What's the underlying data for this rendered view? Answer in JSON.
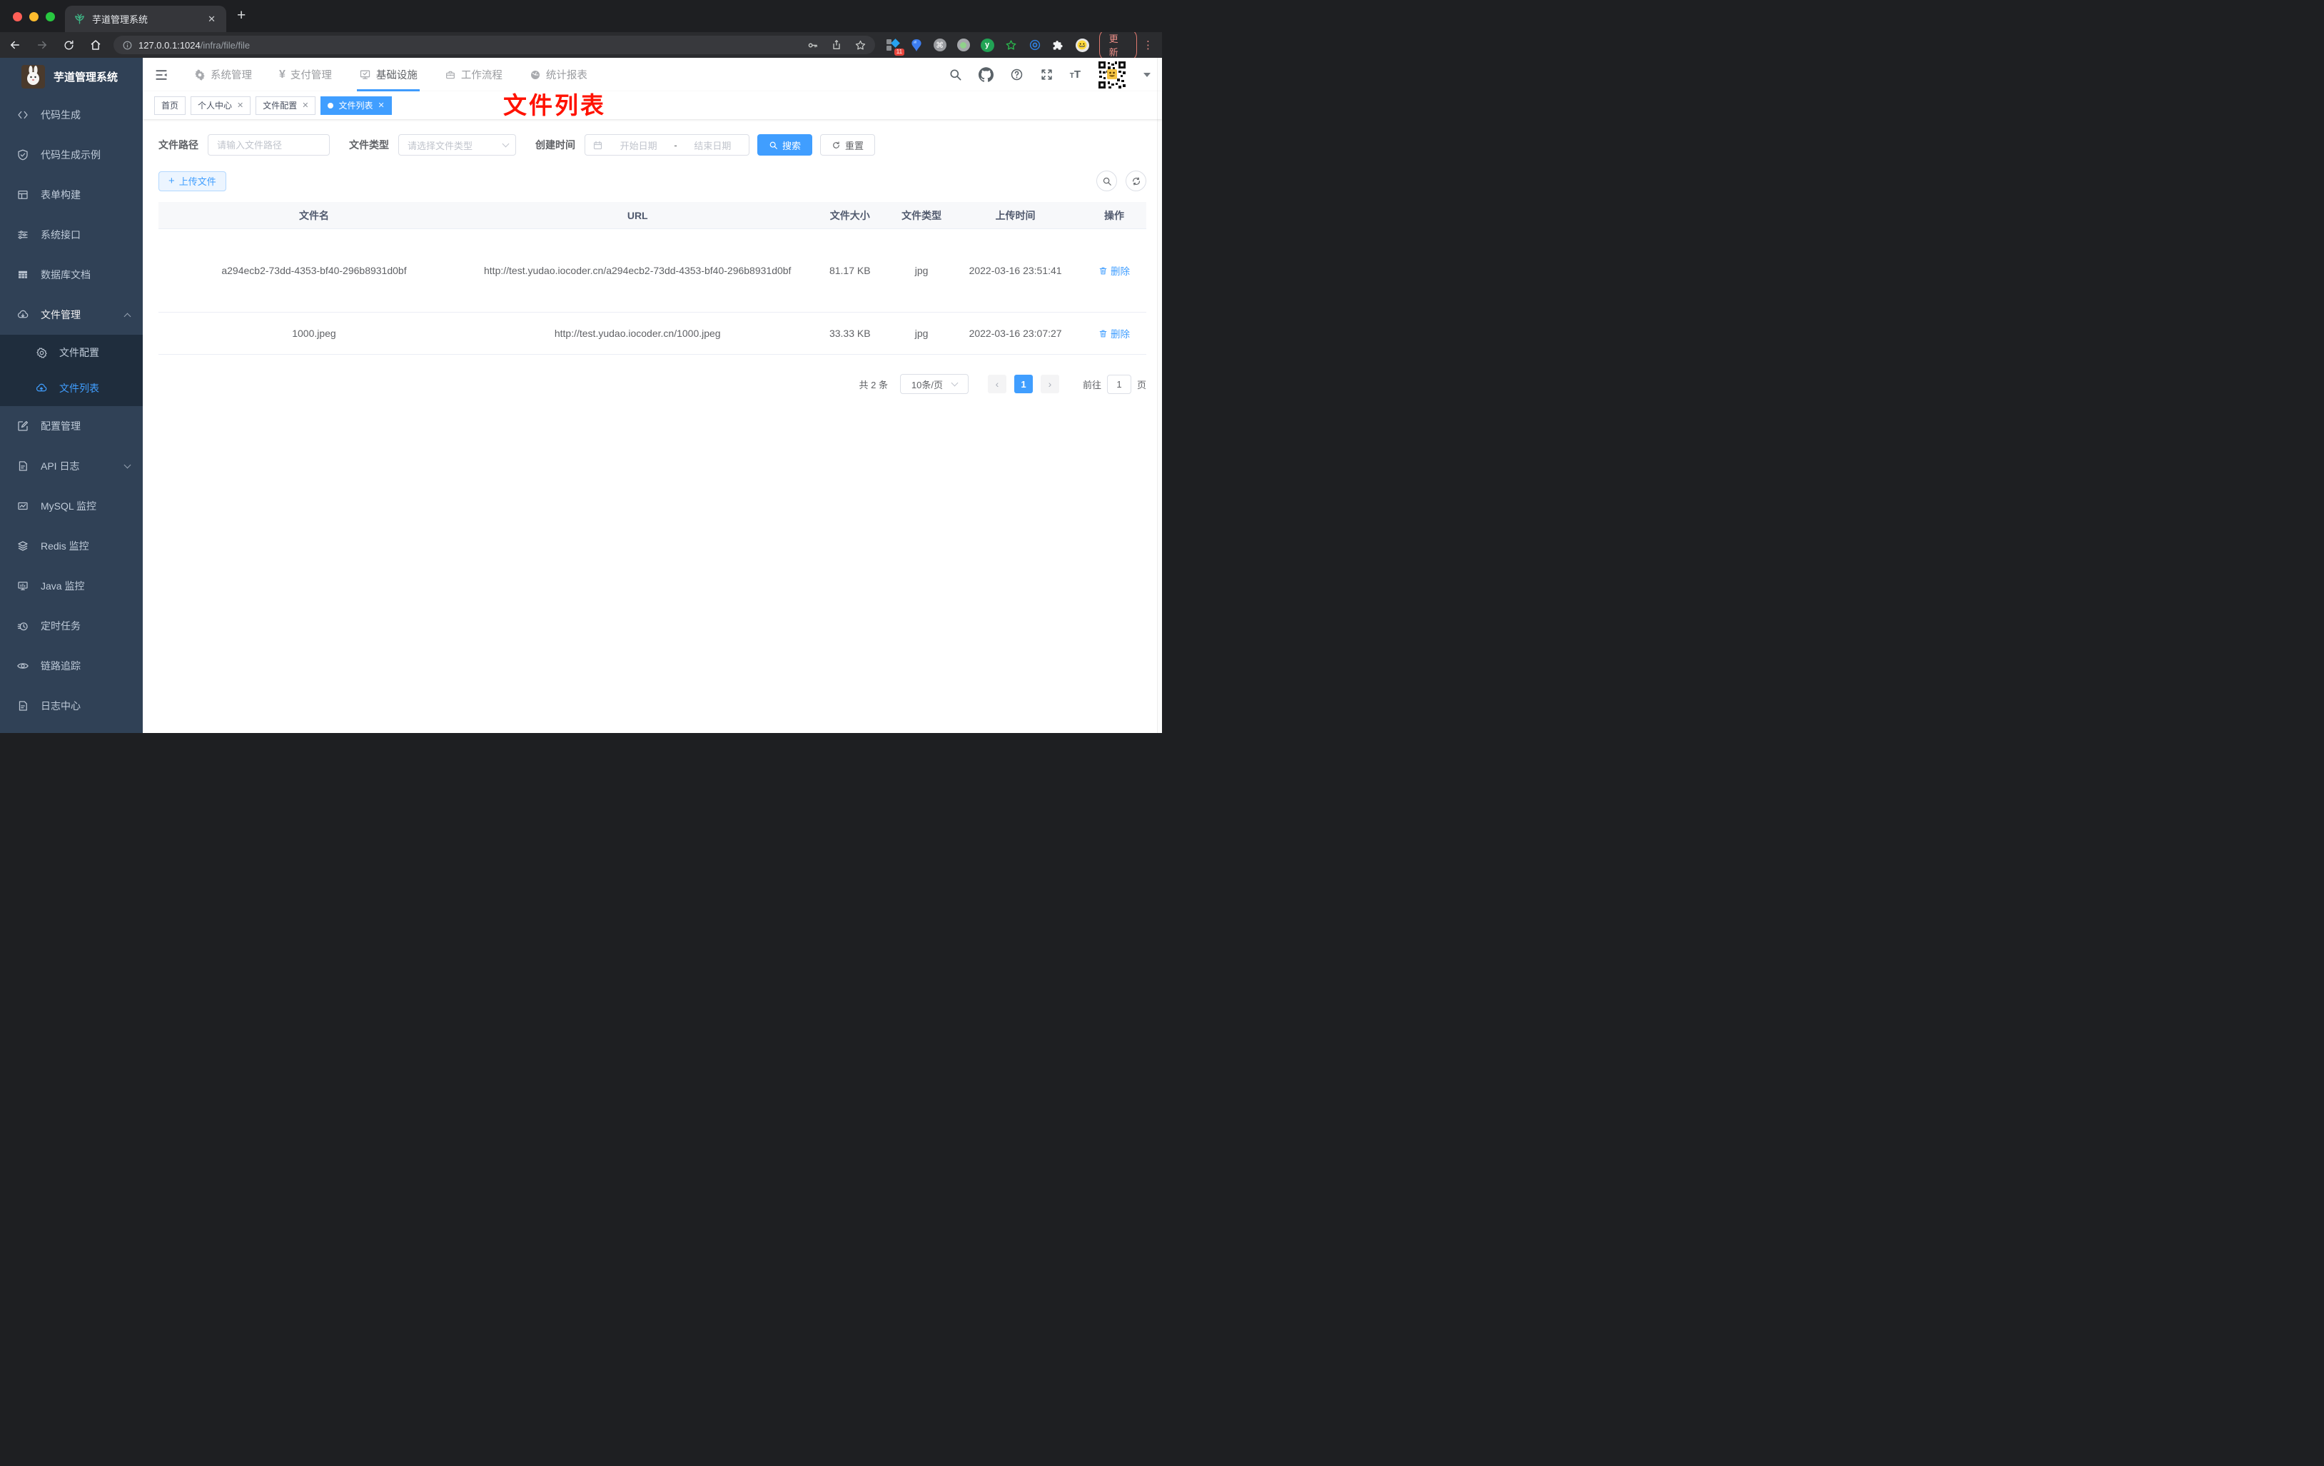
{
  "browser": {
    "tab_title": "芋道管理系统",
    "tab_close": "✕",
    "new_tab": "+",
    "url_host": "127.0.0.1:1024",
    "url_path": "/infra/file/file",
    "extension_badge": "11",
    "extension_y_label": "y",
    "update_label": "更新",
    "kebab": "⋮"
  },
  "sidebar": {
    "title": "芋道管理系统",
    "items": [
      {
        "label": "代码生成",
        "icon": "code-icon"
      },
      {
        "label": "代码生成示例",
        "icon": "shield-check-icon"
      },
      {
        "label": "表单构建",
        "icon": "form-grid-icon"
      },
      {
        "label": "系统接口",
        "icon": "sliders-icon"
      },
      {
        "label": "数据库文档",
        "icon": "db-table-icon"
      },
      {
        "label": "文件管理",
        "icon": "cloud-download-icon",
        "expanded": true
      },
      {
        "label": "文件配置",
        "icon": "gear-icon",
        "submenu": true
      },
      {
        "label": "文件列表",
        "icon": "cloud-upload-icon",
        "submenu": true,
        "active": true
      },
      {
        "label": "配置管理",
        "icon": "edit-square-icon"
      },
      {
        "label": "API 日志",
        "icon": "doc-edit-icon",
        "collapsed": true
      },
      {
        "label": "MySQL 监控",
        "icon": "chart-box-icon"
      },
      {
        "label": "Redis 监控",
        "icon": "layers-icon"
      },
      {
        "label": "Java 监控",
        "icon": "monitor-bars-icon"
      },
      {
        "label": "定时任务",
        "icon": "timer-icon"
      },
      {
        "label": "链路追踪",
        "icon": "eye-icon"
      },
      {
        "label": "日志中心",
        "icon": "doc-edit-icon"
      }
    ]
  },
  "topnav": {
    "menus": [
      {
        "label": "系统管理",
        "icon": "gear-icon"
      },
      {
        "label": "支付管理",
        "icon": "yen-icon"
      },
      {
        "label": "基础设施",
        "icon": "monitor-check-icon",
        "active": true
      },
      {
        "label": "工作流程",
        "icon": "briefcase-icon"
      },
      {
        "label": "统计报表",
        "icon": "dashboard-icon"
      }
    ]
  },
  "tags": [
    {
      "label": "首页"
    },
    {
      "label": "个人中心",
      "closable": true
    },
    {
      "label": "文件配置",
      "closable": true
    },
    {
      "label": "文件列表",
      "closable": true,
      "active": true
    }
  ],
  "tag_close": "✕",
  "annotation": "文件列表",
  "filters": {
    "path_label": "文件路径",
    "path_placeholder": "请输入文件路径",
    "type_label": "文件类型",
    "type_placeholder": "请选择文件类型",
    "date_label": "创建时间",
    "date_start": "开始日期",
    "date_separator": "-",
    "date_end": "结束日期",
    "search_label": "搜索",
    "reset_label": "重置"
  },
  "toolbar": {
    "upload_label": "上传文件",
    "plus": "+"
  },
  "table": {
    "headers": [
      "文件名",
      "URL",
      "文件大小",
      "文件类型",
      "上传时间",
      "操作"
    ],
    "rows": [
      {
        "name": "a294ecb2-73dd-4353-bf40-296b8931d0bf",
        "url": "http://test.yudao.iocoder.cn/a294ecb2-73dd-4353-bf40-296b8931d0bf",
        "size": "81.17 KB",
        "type": "jpg",
        "time": "2022-03-16 23:51:41",
        "action": "删除"
      },
      {
        "name": "1000.jpeg",
        "url": "http://test.yudao.iocoder.cn/1000.jpeg",
        "size": "33.33 KB",
        "type": "jpg",
        "time": "2022-03-16 23:07:27",
        "action": "删除"
      }
    ]
  },
  "pagination": {
    "total": "共 2 条",
    "page_size": "10条/页",
    "prev": "‹",
    "page": "1",
    "next": "›",
    "goto_label": "前往",
    "goto_value": "1",
    "page_unit": "页"
  },
  "colors": {
    "accent": "#409eff",
    "sidebar_bg": "#304156",
    "submenu_bg": "#1f2d3d",
    "annotation_red": "#ff1200"
  }
}
